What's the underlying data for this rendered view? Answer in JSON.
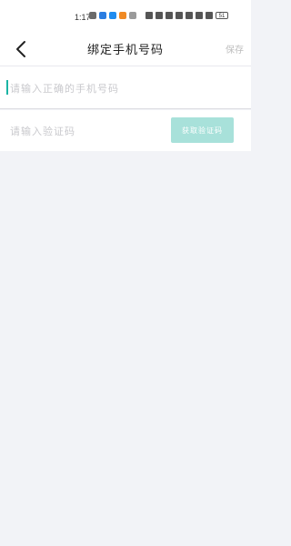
{
  "status_bar": {
    "time": "1:17",
    "battery": "51"
  },
  "header": {
    "title": "绑定手机号码",
    "save_label": "保存"
  },
  "phone_field": {
    "value": "",
    "placeholder": "请输入正确的手机号码"
  },
  "code_field": {
    "value": "",
    "placeholder": "请输入验证码"
  },
  "get_code_button": {
    "label": "获取验证码"
  },
  "colors": {
    "accent": "#1ab4a4",
    "button_disabled_bg": "#a8e1da",
    "page_bg": "#f2f3f7",
    "placeholder": "#c9c9cd",
    "save_disabled": "#bdbdbd"
  }
}
